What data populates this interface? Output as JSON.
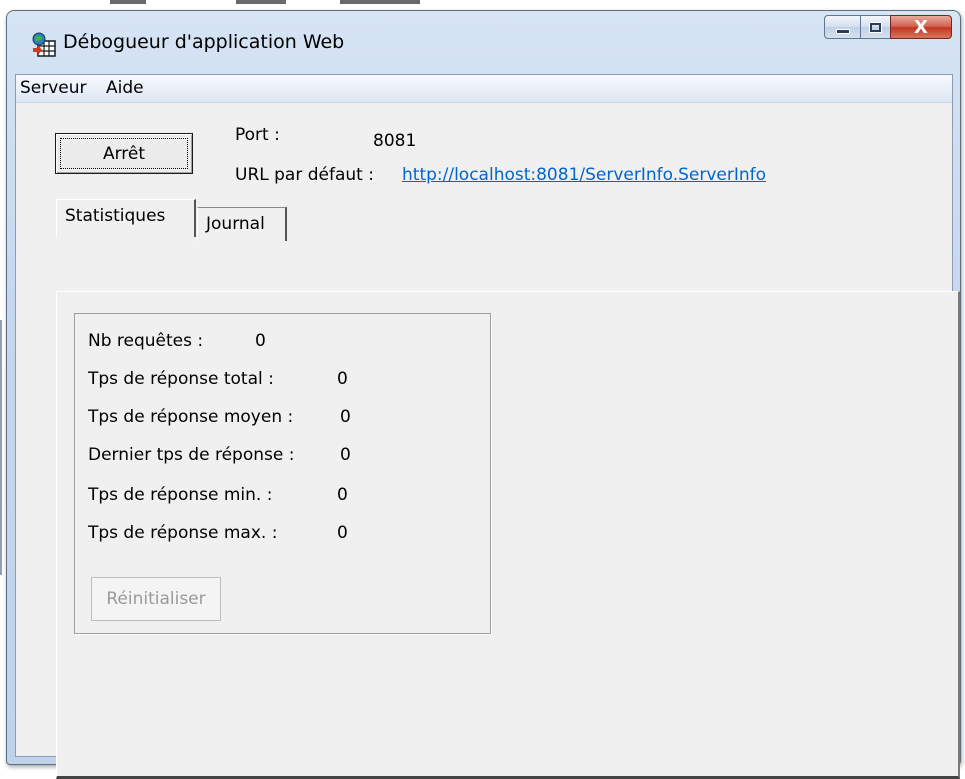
{
  "window": {
    "title": "Débogueur d'application Web",
    "close_glyph": "X"
  },
  "menu": {
    "items": [
      "Serveur",
      "Aide"
    ]
  },
  "server": {
    "stop_button_label": "Arrêt",
    "port_label": "Port :",
    "port_value": "8081",
    "url_label": "URL par défaut :",
    "url_value": "http://localhost:8081/ServerInfo.ServerInfo"
  },
  "tabs": [
    {
      "label": "Statistiques",
      "active": true
    },
    {
      "label": "Journal",
      "active": false
    }
  ],
  "stats": {
    "rows": [
      {
        "label": "Nb requêtes :",
        "value": "0"
      },
      {
        "label": "Tps de réponse total :",
        "value": "0"
      },
      {
        "label": "Tps de réponse moyen :",
        "value": "0"
      },
      {
        "label": "Dernier tps de réponse :",
        "value": "0"
      },
      {
        "label": "Tps de réponse min. :",
        "value": "0"
      },
      {
        "label": "Tps de réponse max. :",
        "value": "0"
      }
    ],
    "reset_button_label": "Réinitialiser"
  },
  "icons": {
    "app": "web-debugger-icon",
    "minimize": "minimize-icon",
    "maximize": "maximize-icon",
    "close": "close-icon"
  },
  "colors": {
    "link": "#0066cc",
    "close_button": "#c2361f",
    "titlebar": "#c5d7ee"
  }
}
